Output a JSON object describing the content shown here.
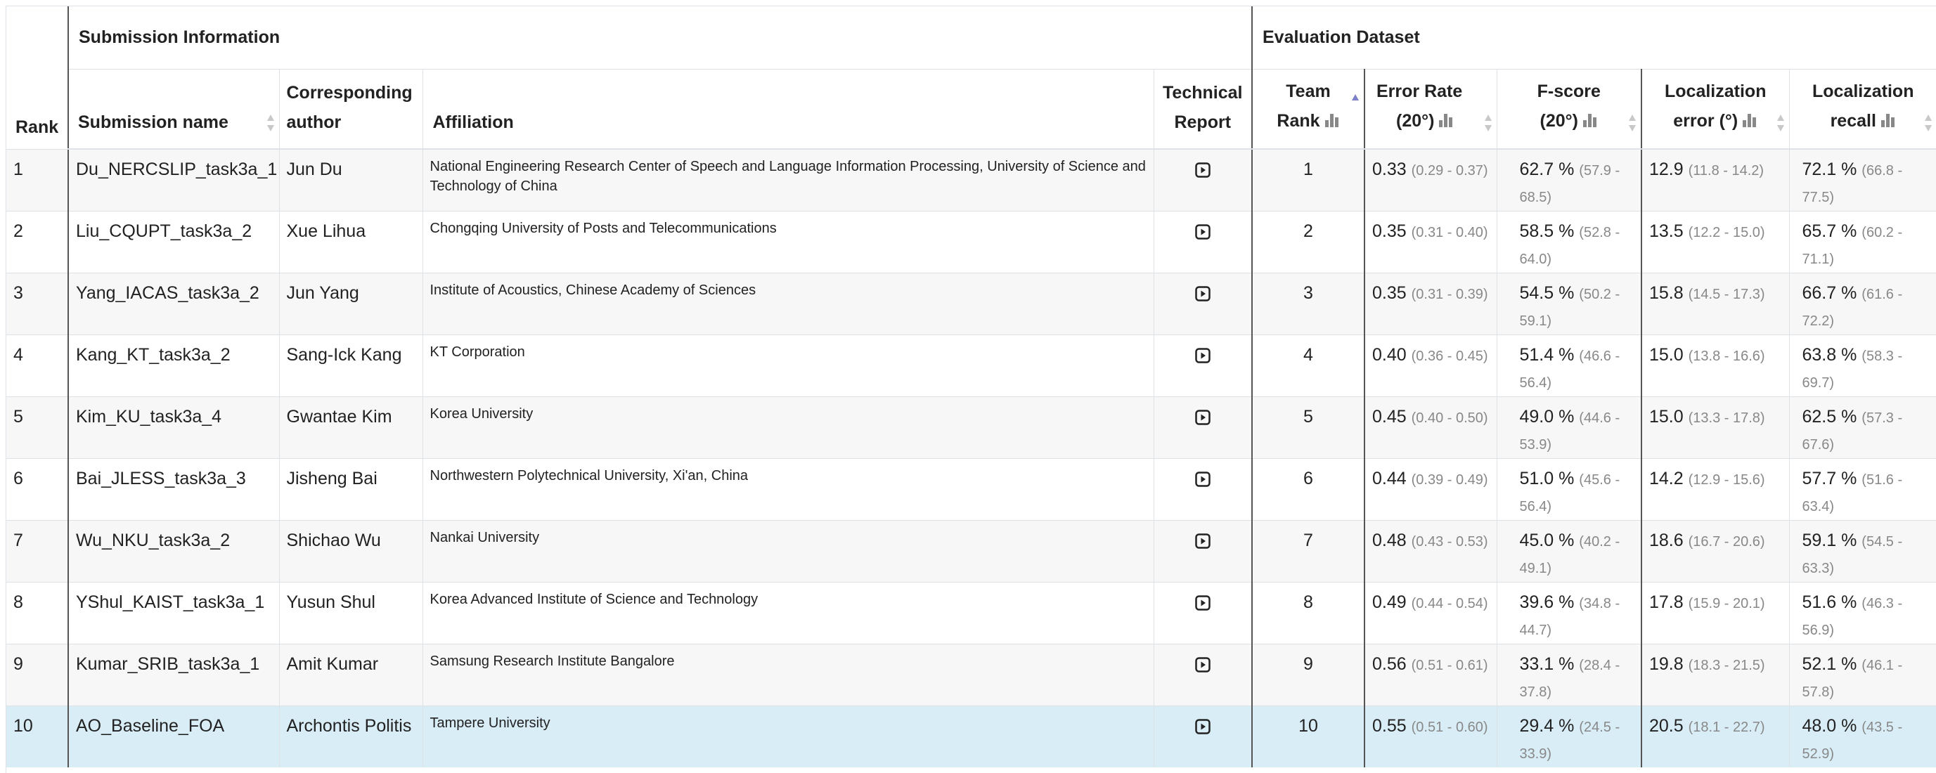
{
  "table": {
    "group_headers": {
      "submission": "Submission Information",
      "evaluation": "Evaluation Dataset"
    },
    "columns": {
      "rank": "Rank",
      "submission_name": "Submission name",
      "author_line1": "Corresponding",
      "author_line2": "author",
      "affiliation": "Affiliation",
      "report_line1": "Technical",
      "report_line2": "Report",
      "team_rank_line1": "Team",
      "team_rank_line2": "Rank",
      "error_rate_line1": "Error Rate",
      "error_rate_line2": "(20°)",
      "fscore_line1": "F-score",
      "fscore_line2": "(20°)",
      "loc_error_line1": "Localization",
      "loc_error_line2": "error (°)",
      "loc_recall_line1": "Localization",
      "loc_recall_line2": "recall"
    },
    "rows": [
      {
        "rank": "1",
        "name": "Du_NERCSLIP_task3a_1",
        "author": "Jun Du",
        "affiliation": "National Engineering Research Center of Speech and Language Information Processing, University of Science and Technology of China",
        "team_rank": "1",
        "er": "0.33",
        "er_ci": "(0.29 - 0.37)",
        "f": "62.7 %",
        "f_ci": "(57.9 - 68.5)",
        "le": "12.9",
        "le_ci": "(11.8 - 14.2)",
        "lr": "72.1 %",
        "lr_ci": "(66.8 - 77.5)"
      },
      {
        "rank": "2",
        "name": "Liu_CQUPT_task3a_2",
        "author": "Xue Lihua",
        "affiliation": "Chongqing University of Posts and Telecommunications",
        "team_rank": "2",
        "er": "0.35",
        "er_ci": "(0.31 - 0.40)",
        "f": "58.5 %",
        "f_ci": "(52.8 - 64.0)",
        "le": "13.5",
        "le_ci": "(12.2 - 15.0)",
        "lr": "65.7 %",
        "lr_ci": "(60.2 - 71.1)"
      },
      {
        "rank": "3",
        "name": "Yang_IACAS_task3a_2",
        "author": "Jun Yang",
        "affiliation": "Institute of Acoustics, Chinese Academy of Sciences",
        "team_rank": "3",
        "er": "0.35",
        "er_ci": "(0.31 - 0.39)",
        "f": "54.5 %",
        "f_ci": "(50.2 - 59.1)",
        "le": "15.8",
        "le_ci": "(14.5 - 17.3)",
        "lr": "66.7 %",
        "lr_ci": "(61.6 - 72.2)"
      },
      {
        "rank": "4",
        "name": "Kang_KT_task3a_2",
        "author": "Sang-Ick Kang",
        "affiliation": "KT Corporation",
        "team_rank": "4",
        "er": "0.40",
        "er_ci": "(0.36 - 0.45)",
        "f": "51.4 %",
        "f_ci": "(46.6 - 56.4)",
        "le": "15.0",
        "le_ci": "(13.8 - 16.6)",
        "lr": "63.8 %",
        "lr_ci": "(58.3 - 69.7)"
      },
      {
        "rank": "5",
        "name": "Kim_KU_task3a_4",
        "author": "Gwantae Kim",
        "affiliation": "Korea University",
        "team_rank": "5",
        "er": "0.45",
        "er_ci": "(0.40 - 0.50)",
        "f": "49.0 %",
        "f_ci": "(44.6 - 53.9)",
        "le": "15.0",
        "le_ci": "(13.3 - 17.8)",
        "lr": "62.5 %",
        "lr_ci": "(57.3 - 67.6)"
      },
      {
        "rank": "6",
        "name": "Bai_JLESS_task3a_3",
        "author": "Jisheng Bai",
        "affiliation": "Northwestern Polytechnical University, Xi'an, China",
        "team_rank": "6",
        "er": "0.44",
        "er_ci": "(0.39 - 0.49)",
        "f": "51.0 %",
        "f_ci": "(45.6 - 56.4)",
        "le": "14.2",
        "le_ci": "(12.9 - 15.6)",
        "lr": "57.7 %",
        "lr_ci": "(51.6 - 63.4)"
      },
      {
        "rank": "7",
        "name": "Wu_NKU_task3a_2",
        "author": "Shichao Wu",
        "affiliation": "Nankai University",
        "team_rank": "7",
        "er": "0.48",
        "er_ci": "(0.43 - 0.53)",
        "f": "45.0 %",
        "f_ci": "(40.2 - 49.1)",
        "le": "18.6",
        "le_ci": "(16.7 - 20.6)",
        "lr": "59.1 %",
        "lr_ci": "(54.5 - 63.3)"
      },
      {
        "rank": "8",
        "name": "YShul_KAIST_task3a_1",
        "author": "Yusun Shul",
        "affiliation": "Korea Advanced Institute of Science and Technology",
        "team_rank": "8",
        "er": "0.49",
        "er_ci": "(0.44 - 0.54)",
        "f": "39.6 %",
        "f_ci": "(34.8 - 44.7)",
        "le": "17.8",
        "le_ci": "(15.9 - 20.1)",
        "lr": "51.6 %",
        "lr_ci": "(46.3 - 56.9)"
      },
      {
        "rank": "9",
        "name": "Kumar_SRIB_task3a_1",
        "author": "Amit Kumar",
        "affiliation": "Samsung Research Institute Bangalore",
        "team_rank": "9",
        "er": "0.56",
        "er_ci": "(0.51 - 0.61)",
        "f": "33.1 %",
        "f_ci": "(28.4 - 37.8)",
        "le": "19.8",
        "le_ci": "(18.3 - 21.5)",
        "lr": "52.1 %",
        "lr_ci": "(46.1 - 57.8)"
      },
      {
        "rank": "10",
        "name": "AO_Baseline_FOA",
        "author": "Archontis Politis",
        "affiliation": "Tampere University",
        "team_rank": "10",
        "er": "0.55",
        "er_ci": "(0.51 - 0.60)",
        "f": "29.4 %",
        "f_ci": "(24.5 - 33.9)",
        "le": "20.5",
        "le_ci": "(18.1 - 22.7)",
        "lr": "48.0 %",
        "lr_ci": "(43.5 - 52.9)",
        "highlight": true
      }
    ]
  },
  "icons": {
    "sort": "sort-arrows-icon",
    "sort_active": "sort-ascending-icon",
    "chart": "bar-chart-icon",
    "report": "document-play-icon"
  },
  "colors": {
    "highlight_row": "#d9edf7",
    "stripe_row": "#f7f7f7",
    "active_sort": "#7d7fc9",
    "ci_text": "#888888"
  }
}
